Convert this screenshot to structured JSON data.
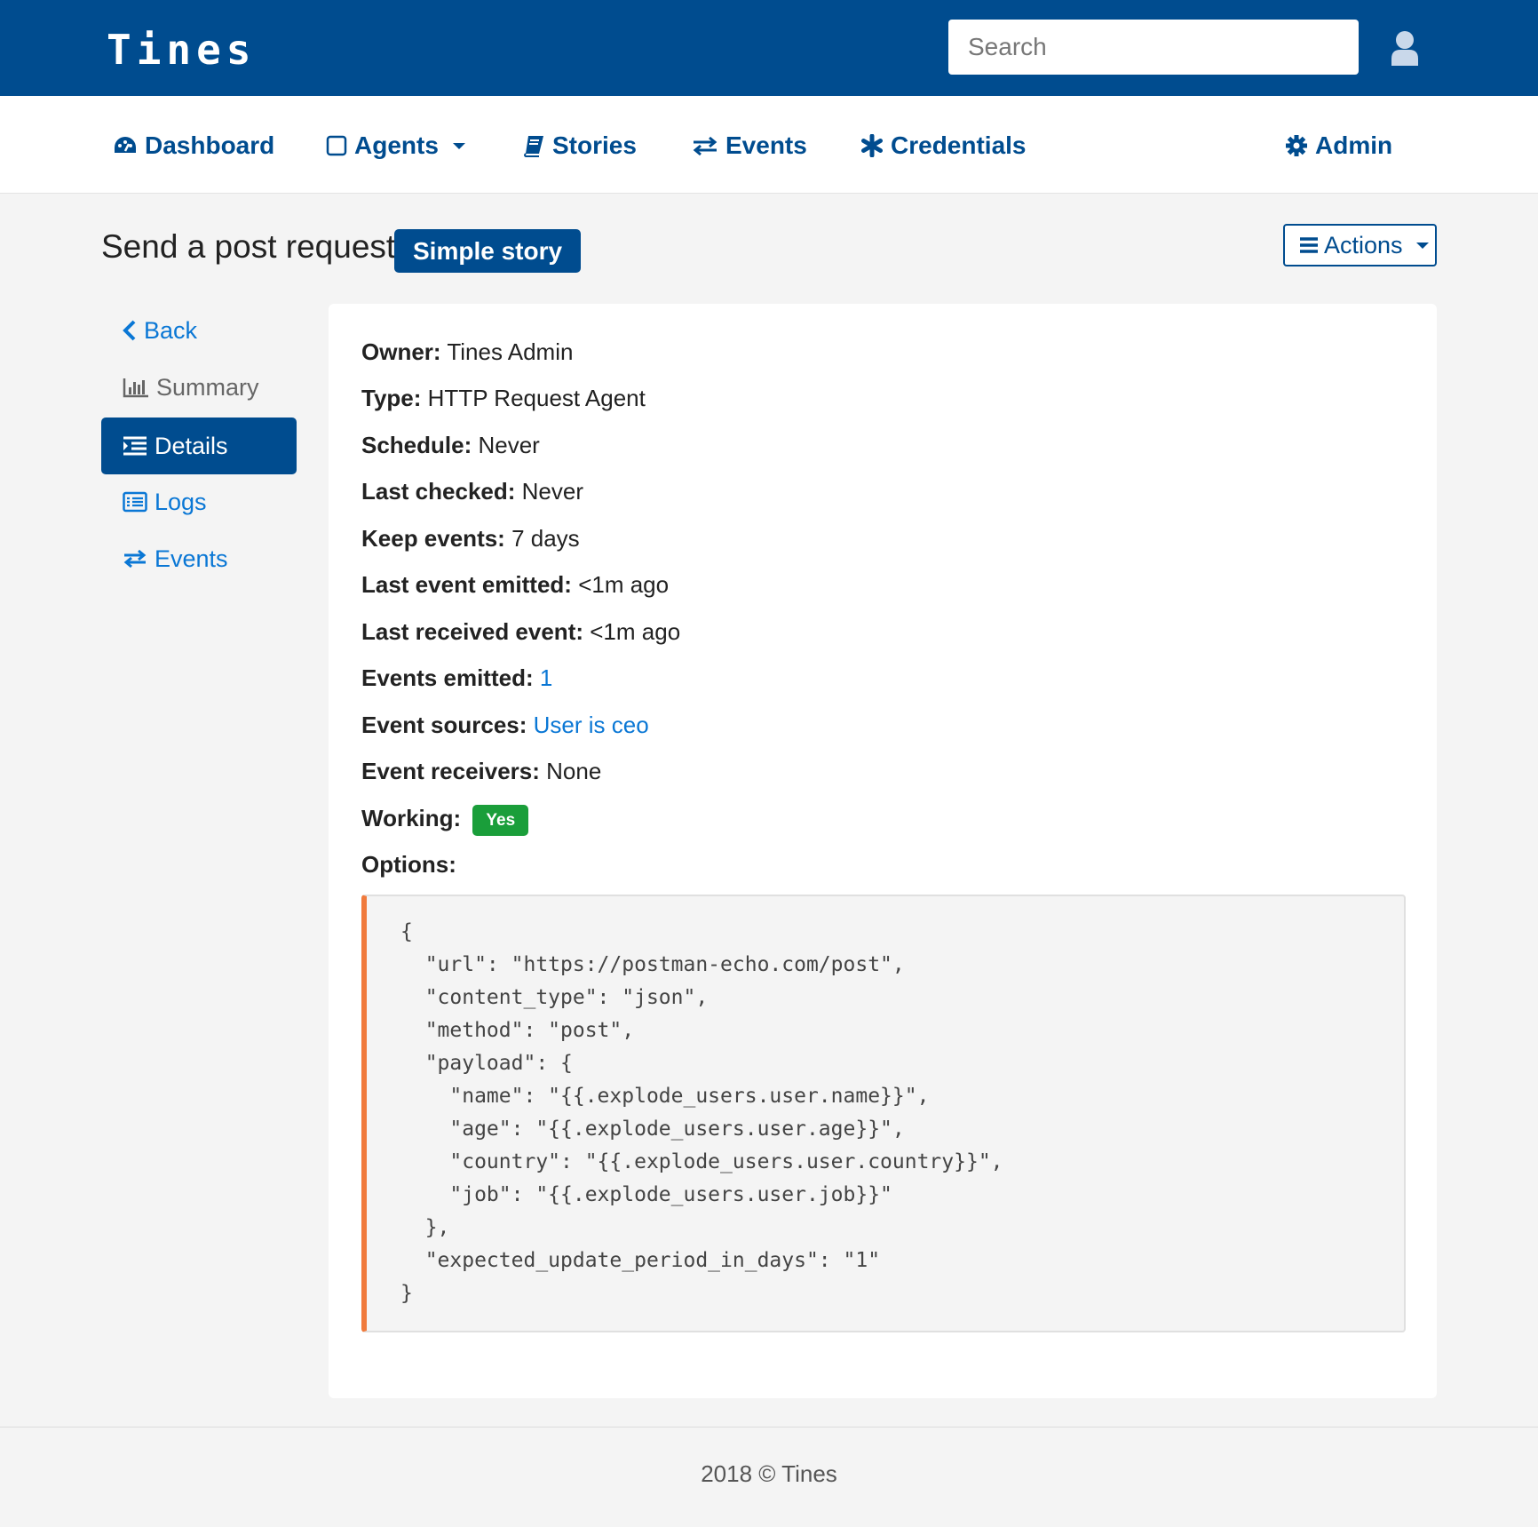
{
  "header": {
    "logo": "Tines",
    "search_placeholder": "Search"
  },
  "nav": {
    "dashboard": "Dashboard",
    "agents": "Agents",
    "stories": "Stories",
    "events": "Events",
    "credentials": "Credentials",
    "admin": "Admin"
  },
  "page": {
    "title": "Send a post request",
    "story_badge": "Simple story",
    "actions_label": "Actions"
  },
  "side_menu": {
    "back": "Back",
    "summary": "Summary",
    "details": "Details",
    "logs": "Logs",
    "events": "Events"
  },
  "details": {
    "owner_label": "Owner:",
    "owner": "Tines Admin",
    "type_label": "Type:",
    "type": "HTTP Request Agent",
    "schedule_label": "Schedule:",
    "schedule": "Never",
    "last_checked_label": "Last checked:",
    "last_checked": "Never",
    "keep_events_label": "Keep events:",
    "keep_events": "7 days",
    "last_event_emitted_label": "Last event emitted:",
    "last_event_emitted": "<1m ago",
    "last_received_event_label": "Last received event:",
    "last_received_event": "<1m ago",
    "events_emitted_label": "Events emitted:",
    "events_emitted": "1",
    "event_sources_label": "Event sources:",
    "event_sources": "User is ceo",
    "event_receivers_label": "Event receivers:",
    "event_receivers": "None",
    "working_label": "Working:",
    "working": "Yes",
    "options_label": "Options:",
    "options_code": "{\n  \"url\": \"https://postman-echo.com/post\",\n  \"content_type\": \"json\",\n  \"method\": \"post\",\n  \"payload\": {\n    \"name\": \"{{.explode_users.user.name}}\",\n    \"age\": \"{{.explode_users.user.age}}\",\n    \"country\": \"{{.explode_users.user.country}}\",\n    \"job\": \"{{.explode_users.user.job}}\"\n  },\n  \"expected_update_period_in_days\": \"1\"\n}"
  },
  "footer": {
    "text": "2018 © Tines"
  },
  "colors": {
    "brand": "#004c8f",
    "link": "#0a77d5",
    "success": "#1a9e3a",
    "code_accent": "#f07a3c"
  }
}
